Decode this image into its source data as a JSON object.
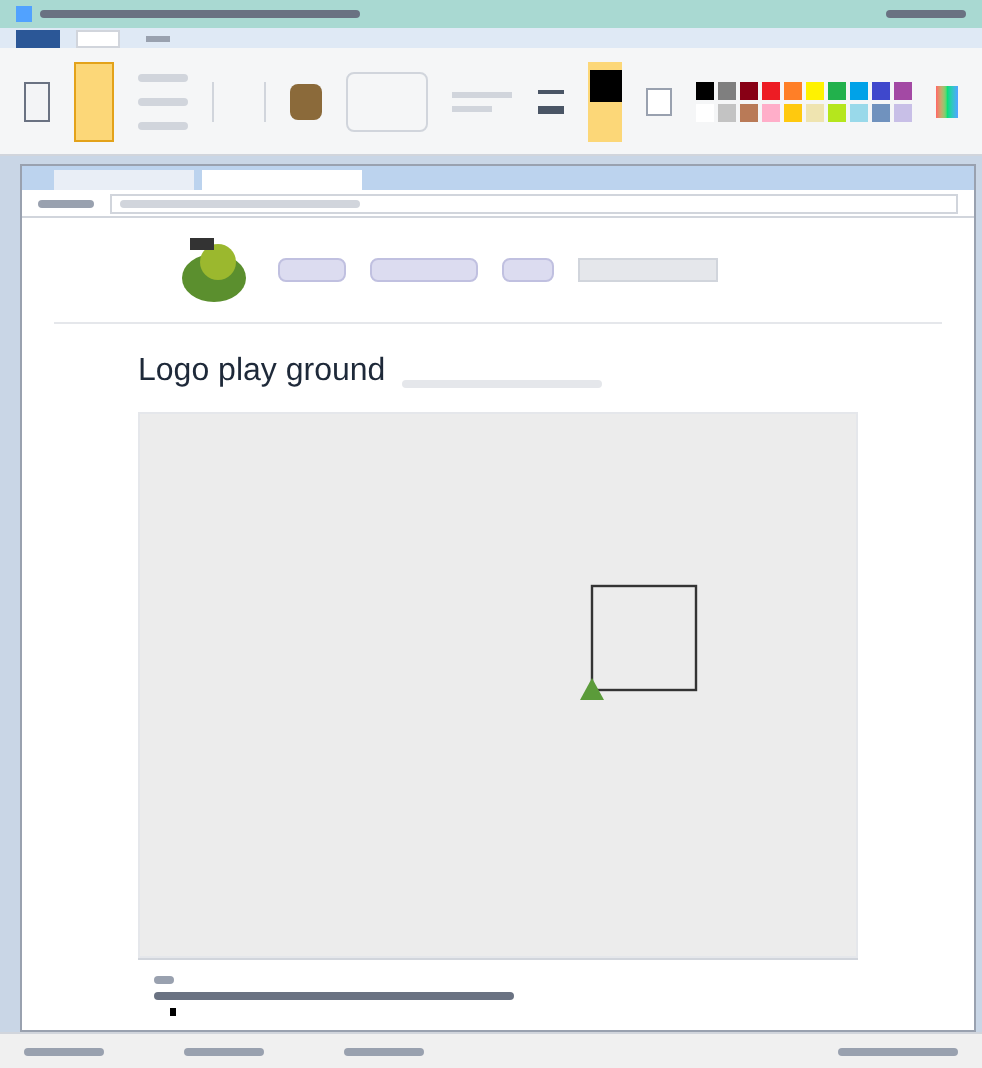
{
  "palette": {
    "primary": {
      "color": "#000000"
    },
    "secondary": {
      "color": "#ffffff"
    },
    "colors": [
      {
        "color": "#000000"
      },
      {
        "color": "#7f7f7f"
      },
      {
        "color": "#880015"
      },
      {
        "color": "#ed1c24"
      },
      {
        "color": "#ff7f27"
      },
      {
        "color": "#fff200"
      },
      {
        "color": "#22b14c"
      },
      {
        "color": "#00a2e8"
      },
      {
        "color": "#3f48cc"
      },
      {
        "color": "#a349a4"
      },
      {
        "color": "#ffffff"
      },
      {
        "color": "#c3c3c3"
      },
      {
        "color": "#b97a57"
      },
      {
        "color": "#ffaec9"
      },
      {
        "color": "#ffc90e"
      },
      {
        "color": "#efe4b0"
      },
      {
        "color": "#b5e61d"
      },
      {
        "color": "#99d9ea"
      },
      {
        "color": "#7092be"
      },
      {
        "color": "#c8bfe7"
      }
    ]
  },
  "page": {
    "heading": "Logo play ground"
  }
}
